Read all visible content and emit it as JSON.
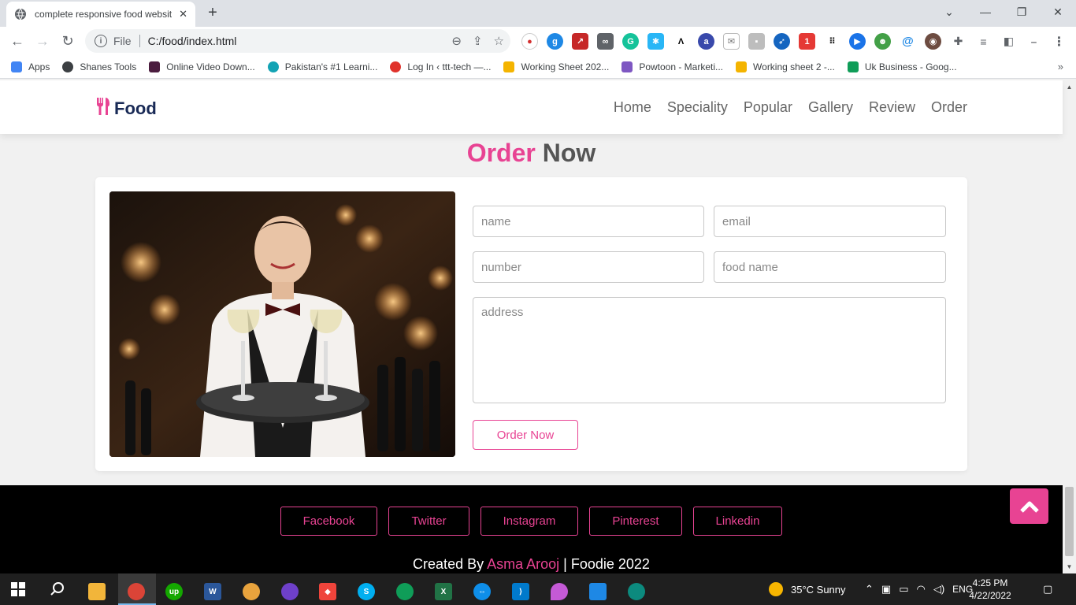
{
  "browser": {
    "tab_title": "complete responsive food websit",
    "url_scheme_label": "File",
    "url": "C:/food/index.html",
    "bookmarks": [
      {
        "label": "Apps",
        "color": "#4285f4"
      },
      {
        "label": "Shanes Tools",
        "color": "#3c4043"
      },
      {
        "label": "Online Video Down...",
        "color": "#4b1d3f"
      },
      {
        "label": "Pakistan's #1 Learni...",
        "color": "#13a3b4"
      },
      {
        "label": "Log In ‹ ttt-tech —...",
        "color": "#e0322b"
      },
      {
        "label": "Working Sheet 202...",
        "color": "#f4b400"
      },
      {
        "label": "Powtoon - Marketi...",
        "color": "#7e57c2"
      },
      {
        "label": "Working sheet 2 -...",
        "color": "#f4b400"
      },
      {
        "label": "Uk Business - Goog...",
        "color": "#0f9d58"
      }
    ]
  },
  "site": {
    "brand": "Food",
    "nav": [
      "Home",
      "Speciality",
      "Popular",
      "Gallery",
      "Review",
      "Order"
    ],
    "section_title_accent": "Order",
    "section_title_rest": "Now",
    "form": {
      "name_placeholder": "name",
      "email_placeholder": "email",
      "number_placeholder": "number",
      "food_placeholder": "food name",
      "address_placeholder": "address",
      "submit_label": "Order Now"
    },
    "social": [
      "Facebook",
      "Twitter",
      "Instagram",
      "Pinterest",
      "Linkedin"
    ],
    "credit_prefix": "Created By",
    "credit_name": "Asma Arooj",
    "credit_suffix": "| Foodie 2022"
  },
  "taskbar": {
    "weather": "35°C  Sunny",
    "language": "ENG",
    "time": "4:25 PM",
    "date": "4/22/2022"
  },
  "colors": {
    "accent": "#e84393",
    "footer_bg": "#000000"
  }
}
